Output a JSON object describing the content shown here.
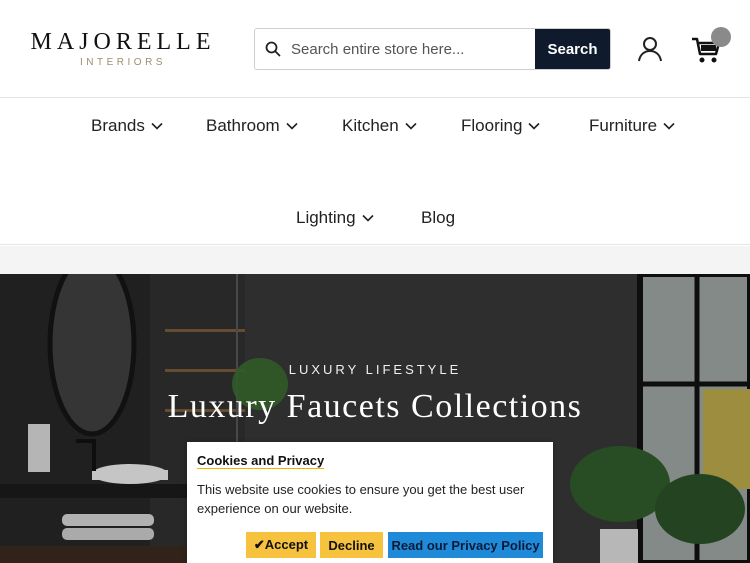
{
  "header": {
    "logo_main": "MAJORELLE",
    "logo_sub": "INTERIORS",
    "search_placeholder": "Search entire store here...",
    "search_button": "Search"
  },
  "nav": {
    "items": [
      {
        "label": "Brands",
        "has_dropdown": true
      },
      {
        "label": "Bathroom",
        "has_dropdown": true
      },
      {
        "label": "Kitchen",
        "has_dropdown": true
      },
      {
        "label": "Flooring",
        "has_dropdown": true
      },
      {
        "label": "Furniture",
        "has_dropdown": true
      },
      {
        "label": "Lighting",
        "has_dropdown": true
      },
      {
        "label": "Blog",
        "has_dropdown": false
      }
    ]
  },
  "hero": {
    "tagline": "LUXURY LIFESTYLE",
    "title": "Luxury Faucets Collections"
  },
  "cookie": {
    "title": "Cookies and Privacy",
    "text": "This website use cookies to ensure you get the best user experience on our website.",
    "accept": "✔Accept",
    "decline": "Decline",
    "policy": "Read our Privacy Policy"
  },
  "colors": {
    "search_button_bg": "#0f1b2d",
    "accept_bg": "#f7c33f",
    "policy_bg": "#1f8ad8",
    "logo_sub": "#9a8f6a"
  }
}
